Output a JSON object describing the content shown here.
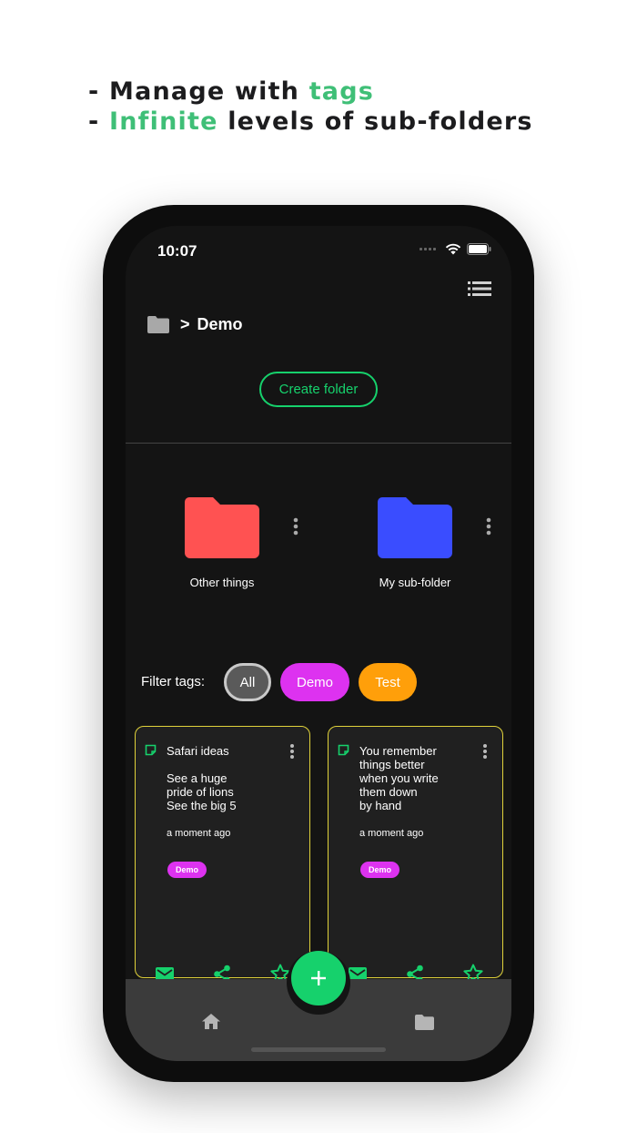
{
  "headline": {
    "line1_prefix": "- Manage with ",
    "line1_accent": "tags",
    "line2_prefix": "- ",
    "line2_accent": "Infinite",
    "line2_suffix": " levels of sub-folders"
  },
  "status_bar": {
    "time": "10:07"
  },
  "breadcrumb": {
    "separator": ">",
    "current": "Demo"
  },
  "create_folder_label": "Create folder",
  "folders": [
    {
      "name": "Other things",
      "color": "#ff5252"
    },
    {
      "name": "My sub-folder",
      "color": "#3a4dff"
    }
  ],
  "filter": {
    "label": "Filter tags:",
    "tags": [
      {
        "label": "All",
        "color": "#5a5a5a",
        "selected": true
      },
      {
        "label": "Demo",
        "color": "#dd32f0"
      },
      {
        "label": "Test",
        "color": "#ff9f0a"
      }
    ]
  },
  "notes": [
    {
      "title": "Safari ideas",
      "body": [
        "See a huge",
        "pride of lions",
        "See the big 5"
      ],
      "time": "a moment ago",
      "tag": "Demo"
    },
    {
      "title": "You remember things better when you write them down by hand",
      "title_lines": [
        "You remember",
        "things better",
        "when you write",
        "them down",
        "by hand"
      ],
      "body": [],
      "time": "a moment ago",
      "tag": "Demo"
    }
  ],
  "colors": {
    "accent_green": "#16d16c",
    "note_border": "#e0d23a",
    "background": "#141414",
    "bottom_bar": "#3b3b3b"
  },
  "icons": {
    "note_actions": [
      "mail-icon",
      "share-icon",
      "star-icon"
    ],
    "bottom_nav": [
      "home-icon",
      "folder-icon"
    ],
    "fab": "plus-icon"
  }
}
